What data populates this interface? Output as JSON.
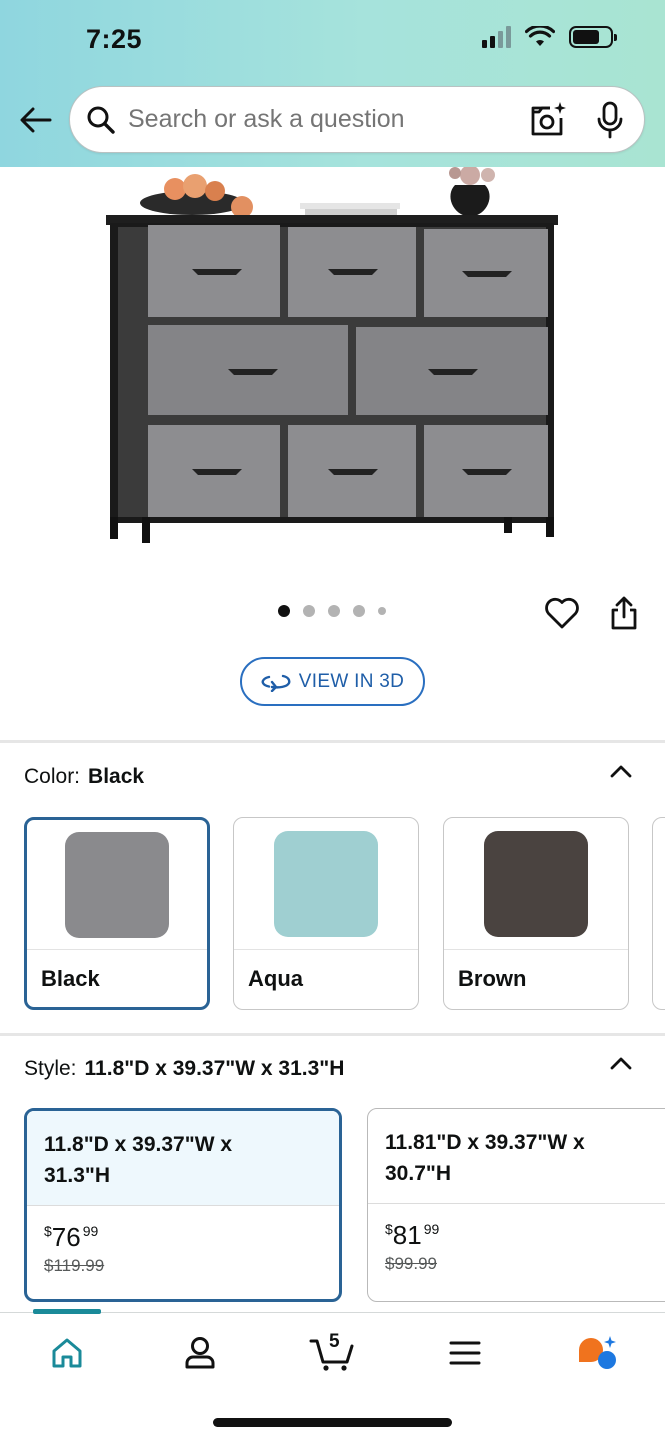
{
  "status": {
    "time": "7:25"
  },
  "search": {
    "placeholder": "Search or ask a question"
  },
  "gallery": {
    "dots": 5,
    "active_index": 0
  },
  "view3d": {
    "label": "VIEW IN 3D"
  },
  "color_section": {
    "label": "Color:",
    "selected": "Black",
    "options": [
      {
        "name": "Black",
        "swatch": "#8a8a8d"
      },
      {
        "name": "Aqua",
        "swatch": "#9fcfd1"
      },
      {
        "name": "Brown",
        "swatch": "#4a4340"
      }
    ]
  },
  "style_section": {
    "label": "Style:",
    "selected": "11.8\"D x 39.37\"W x 31.3\"H",
    "options": [
      {
        "line1": "11.8\"D x 39.37\"W x",
        "line2": "31.3\"H",
        "price_symbol": "$",
        "price_whole": "76",
        "price_cents": "99",
        "list_price": "$119.99"
      },
      {
        "line1": "11.81\"D x 39.37\"W x",
        "line2": "30.7\"H",
        "price_symbol": "$",
        "price_whole": "81",
        "price_cents": "99",
        "list_price": "$99.99"
      }
    ]
  },
  "bottom_nav": {
    "cart_count": "5"
  },
  "colors": {
    "accent": "#2a6395",
    "teal": "#1a8a99",
    "link": "#1f5ea8"
  }
}
